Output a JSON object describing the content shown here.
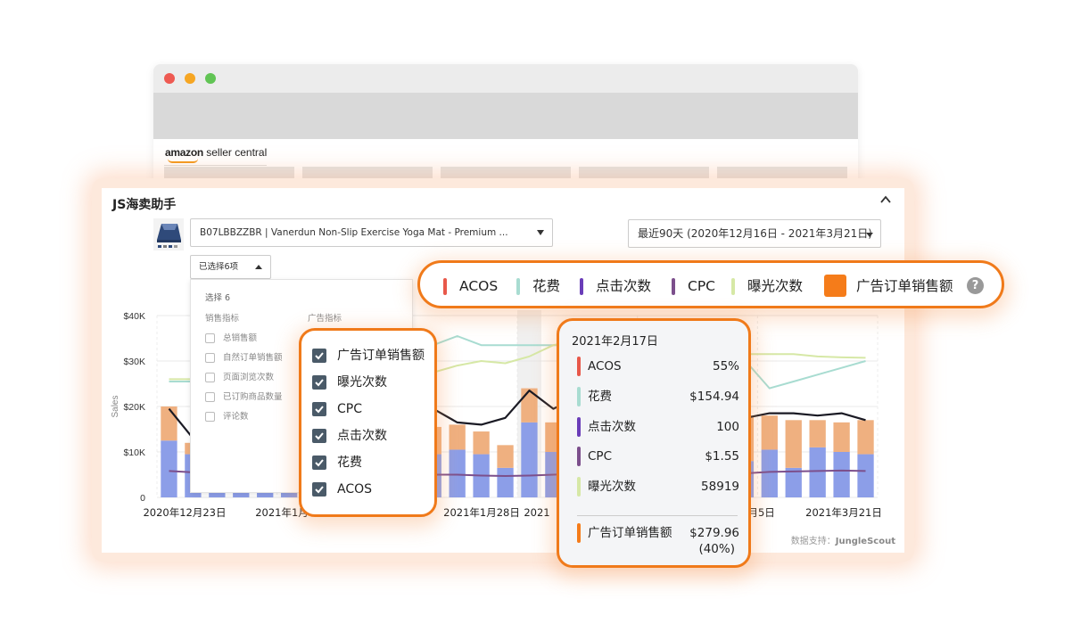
{
  "browser": {
    "brand_main": "amazon",
    "brand_sub": "seller central"
  },
  "panel": {
    "title": "JS海卖助手",
    "product": "B07LBBZZBR | Vanerdun Non-Slip Exercise Yoga Mat - Premium ...",
    "date_range": "最近90天 (2020年12月16日 - 2021年3月21日)",
    "metric_select": "已选择6项",
    "credit_prefix": "数据支持：",
    "credit_brand": "JungleScout"
  },
  "dropdown": {
    "count": "选择 6",
    "sales_header": "销售指标",
    "ad_header": "广告指标",
    "sales_items": [
      "总销售额",
      "自然订单销售额",
      "页面浏览次数",
      "已订购商品数量",
      "评论数"
    ]
  },
  "checkbox_panel": {
    "items": [
      "广告订单销售额",
      "曝光次数",
      "CPC",
      "点击次数",
      "花费",
      "ACOS"
    ]
  },
  "legend": {
    "items": [
      {
        "label": "ACOS",
        "color": "#e8584a"
      },
      {
        "label": "花费",
        "color": "#a8dcd1"
      },
      {
        "label": "点击次数",
        "color": "#6a3db8"
      },
      {
        "label": "CPC",
        "color": "#7c4f8c"
      },
      {
        "label": "曝光次数",
        "color": "#d6e8a6"
      },
      {
        "label": "广告订单销售额",
        "color": "#f57c1a"
      }
    ],
    "help": "?"
  },
  "tooltip": {
    "date": "2021年2月17日",
    "rows": [
      {
        "label": "ACOS",
        "value": "55%",
        "color": "#e8584a"
      },
      {
        "label": "花费",
        "value": "$154.94",
        "color": "#a8dcd1"
      },
      {
        "label": "点击次数",
        "value": "100",
        "color": "#6a3db8"
      },
      {
        "label": "CPC",
        "value": "$1.55",
        "color": "#7c4f8c"
      },
      {
        "label": "曝光次数",
        "value": "58919",
        "color": "#d6e8a6"
      }
    ],
    "total_label": "广告订单销售额",
    "total_value": "$279.96",
    "total_pct": "(40%)",
    "total_color": "#f57c1a"
  },
  "chart_data": {
    "type": "bar",
    "ylabel": "Sales",
    "yticks": [
      "$40K",
      "$30K",
      "$20K",
      "$10K",
      "0"
    ],
    "ylim": [
      0,
      40000
    ],
    "xtick_labels": [
      "2020年12月23日",
      "2021年1月",
      "2021年1月28日",
      "2021",
      "3月5日",
      "2021年3月21日"
    ],
    "x": [
      "1",
      "2",
      "3",
      "4",
      "5",
      "6",
      "7",
      "8",
      "9",
      "10",
      "11",
      "12",
      "13",
      "14",
      "15",
      "16",
      "17",
      "18",
      "19",
      "20",
      "21",
      "22",
      "23",
      "24",
      "25",
      "26",
      "27",
      "28",
      "29",
      "30"
    ],
    "series": [
      {
        "name": "自然订单销售额",
        "type": "bar",
        "color": "#8c9ee8",
        "values": [
          12500,
          9500,
          8000,
          7000,
          6000,
          5500,
          5500,
          6000,
          6500,
          7500,
          8500,
          9500,
          10500,
          9500,
          6500,
          16500,
          10000,
          11000,
          9000,
          10000,
          9000,
          8500,
          9000,
          9000,
          8000,
          10500,
          6500,
          11000,
          10000,
          9500
        ]
      },
      {
        "name": "广告订单销售额",
        "type": "bar",
        "color": "#efb080",
        "values": [
          7500,
          2500,
          6000,
          6000,
          5500,
          6000,
          6000,
          6000,
          6000,
          7000,
          7000,
          6000,
          5500,
          5000,
          5000,
          7500,
          6500,
          6000,
          6500,
          7000,
          7000,
          6000,
          7500,
          8500,
          10000,
          7500,
          10500,
          6000,
          6500,
          7500
        ]
      },
      {
        "name": "点击次数",
        "type": "line",
        "color": "#1a1a24",
        "values": [
          19500,
          13000,
          13500,
          16000,
          16500,
          17000,
          17000,
          17500,
          18500,
          20000,
          18000,
          19500,
          16500,
          16000,
          17500,
          23500,
          19500,
          22000,
          18500,
          20500,
          19000,
          18000,
          17500,
          18000,
          17500,
          18500,
          18500,
          18000,
          18500,
          17000
        ]
      },
      {
        "name": "CPC",
        "type": "line",
        "color": "#7c4f8c",
        "values": [
          5800,
          5500,
          5200,
          5000,
          5000,
          5000,
          5000,
          5000,
          5000,
          5000,
          5000,
          5000,
          5000,
          4800,
          4700,
          4800,
          5000,
          5200,
          5300,
          5400,
          5400,
          5200,
          5100,
          5200,
          5300,
          5600,
          5700,
          5800,
          5900,
          5800
        ]
      },
      {
        "name": "花费",
        "type": "line",
        "color": "#a8dcd1",
        "values": [
          25500,
          25500,
          25500,
          25500,
          25500,
          25500,
          25500,
          25500,
          25500,
          25500,
          25500,
          33500,
          35500,
          33500,
          33500,
          33500,
          33500,
          33500,
          33500,
          33500,
          33500,
          33500,
          30000,
          30000,
          30000,
          24000,
          25500,
          27000,
          28500,
          30000
        ]
      },
      {
        "name": "曝光次数",
        "type": "line",
        "color": "#d6e8a6",
        "values": [
          26000,
          26000,
          26000,
          26000,
          26000,
          26000,
          26000,
          26000,
          26000,
          26000,
          26000,
          27500,
          29000,
          30000,
          29500,
          31000,
          33500,
          34500,
          33000,
          32500,
          32000,
          32000,
          32000,
          32500,
          31500,
          31500,
          31500,
          31000,
          30800,
          30700
        ]
      }
    ]
  }
}
